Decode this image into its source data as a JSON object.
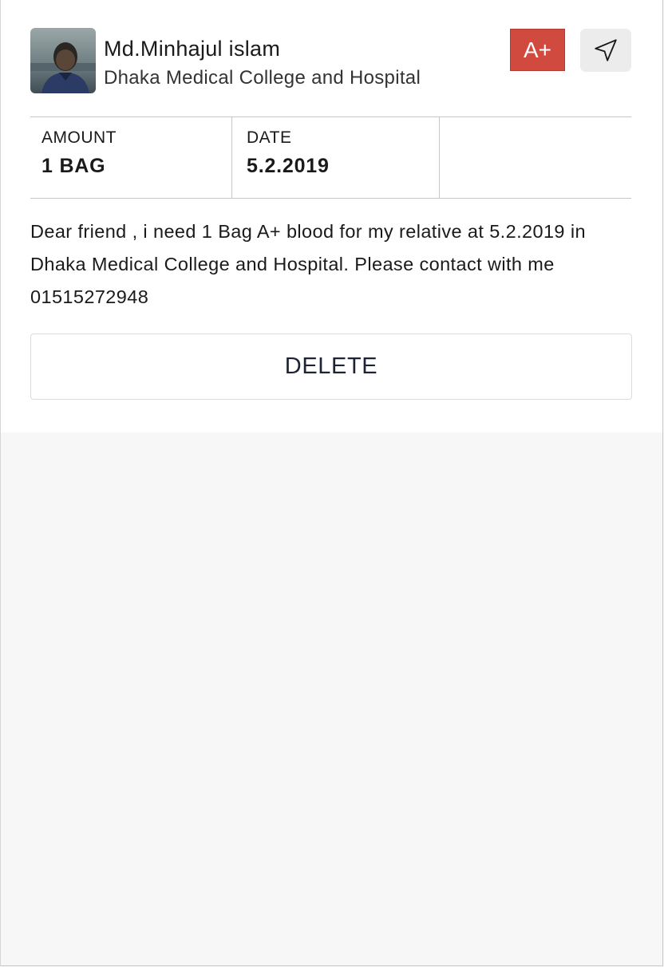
{
  "post": {
    "user_name": "Md.Minhajul islam",
    "hospital": "Dhaka Medical College and Hospital",
    "blood_group": "A+",
    "avatar_icon": "person-photo",
    "nav_icon": "navigation-arrow-icon"
  },
  "details": {
    "amount_label": "AMOUNT",
    "amount_value": "1 BAG",
    "date_label": "DATE",
    "date_value": "5.2.2019"
  },
  "message": "Dear friend , i need 1 Bag A+ blood for my relative at 5.2.2019 in Dhaka Medical College and Hospital. Please contact with me 01515272948",
  "actions": {
    "delete_label": "DELETE"
  },
  "colors": {
    "badge": "#d14a3f",
    "page_background": "#f7f7f7",
    "card_background": "#ffffff",
    "button_text": "#1c2333"
  }
}
